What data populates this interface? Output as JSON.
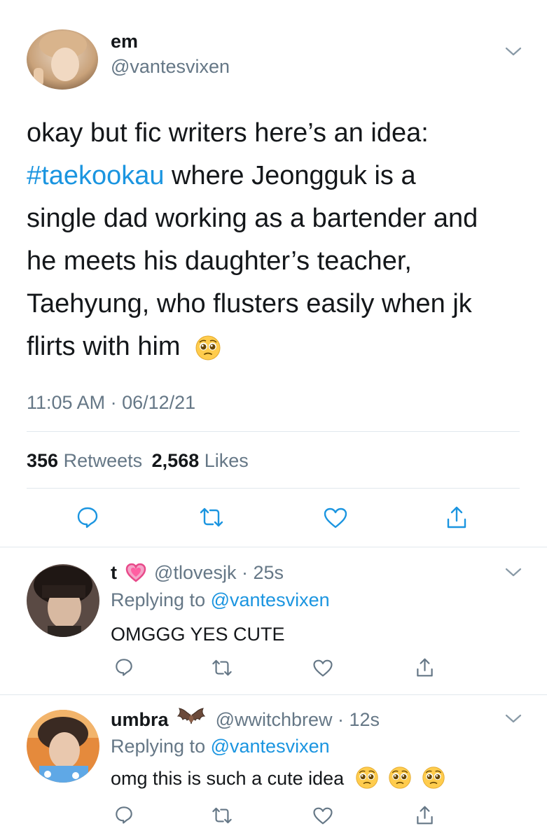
{
  "main_tweet": {
    "display_name": "em",
    "handle": "@vantesvixen",
    "hashtag": "#taekookau",
    "text_line1": "okay but fic writers here’s an idea:",
    "text_line2_rest": " where Jeongguk is a",
    "text_line3": "single dad working as a bartender and",
    "text_line4": "he meets his daughter’s teacher,",
    "text_line5": "Taehyung, who flusters easily when jk",
    "text_line6": "flirts with him",
    "timestamp": "11:05 AM · 06/12/21",
    "retweets_count": "356",
    "retweets_label": "Retweets",
    "likes_count": "2,568",
    "likes_label": "Likes"
  },
  "replies": [
    {
      "display_name": "t",
      "handle": "@tlovesjk",
      "time": "· 25s",
      "replying_prefix": "Replying to",
      "replying_to": "@vantesvixen",
      "text": "OMGGG YES CUTE"
    },
    {
      "display_name": "umbra",
      "handle": "@wwitchbrew",
      "time": "· 12s",
      "replying_prefix": "Replying to",
      "replying_to": "@vantesvixen",
      "text": "omg this is such a cute idea"
    }
  ],
  "icons": [
    "chevron-down-icon",
    "reply-icon",
    "retweet-icon",
    "like-icon",
    "share-icon",
    "pleading-face-emoji",
    "pink-heart-emoji",
    "bat-emoji"
  ],
  "colors": {
    "link": "#1b95e0",
    "secondary": "#657786",
    "border": "#e1e8ed",
    "text": "#14171a"
  }
}
